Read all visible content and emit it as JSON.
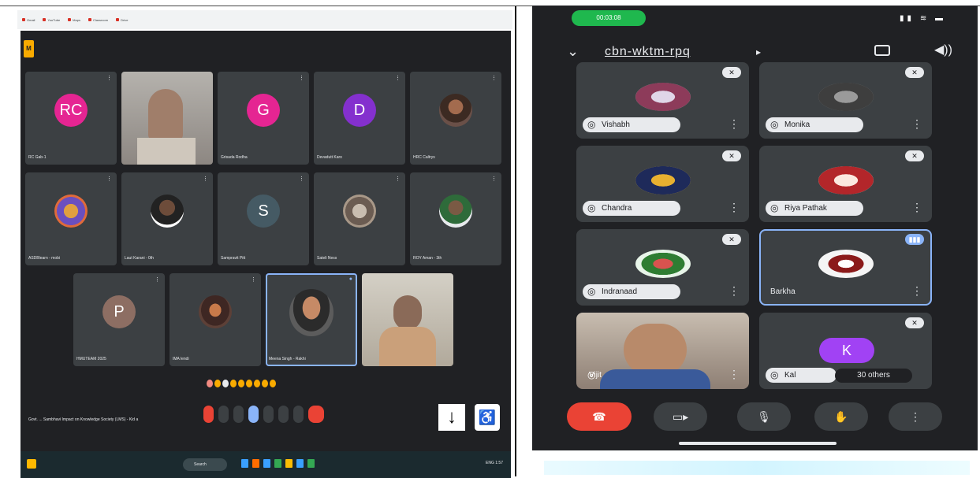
{
  "left": {
    "bookmarks": [
      "Gmail",
      "YouTube",
      "Maps",
      "Classroom",
      "Drive"
    ],
    "meeting_title": "Govt. ... Sambhavi Impact on Knowledge Society (LMS) - Kid a",
    "tiles": [
      {
        "initials": "RC",
        "name": "RC Gab-1",
        "color": "#e52592",
        "video": false
      },
      {
        "initials": "",
        "name": "",
        "color": "",
        "video": true
      },
      {
        "initials": "G",
        "name": "Grisada Rodha",
        "color": "#e52592",
        "video": false
      },
      {
        "initials": "D",
        "name": "Devadutt Karo",
        "color": "#8430ce",
        "video": false
      },
      {
        "initials": "",
        "name": "HRC Caltrys",
        "color": "#6a5048",
        "video": false,
        "photo": true
      },
      {
        "initials": "",
        "name": "ASDBlearn - mobi",
        "color": "#6a5048",
        "video": false,
        "photo": true
      },
      {
        "initials": "",
        "name": "Laut Karani - 0th",
        "color": "#ffffff",
        "video": false,
        "photo": true
      },
      {
        "initials": "S",
        "name": "Sampravit Pitt",
        "color": "#5f6368",
        "video": false
      },
      {
        "initials": "",
        "name": "Sateli Ness",
        "color": "#8d7b70",
        "video": false,
        "photo": true
      },
      {
        "initials": "",
        "name": "ROY Aman - 3th",
        "color": "#e8eaed",
        "video": false,
        "photo": true
      },
      {
        "initials": "P",
        "name": "HMUTEAM 2025",
        "color": "#8d6e63",
        "video": false
      },
      {
        "initials": "",
        "name": "IMA lendi",
        "color": "#5d4037",
        "video": false,
        "photo": true
      },
      {
        "initials": "",
        "name": "Meena Singh - Rakhi",
        "color": "#4e4e4e",
        "video": false,
        "photo": true,
        "speaking": true
      },
      {
        "initials": "",
        "name": "",
        "color": "",
        "video": true
      }
    ],
    "taskbar": {
      "search": "Search",
      "tray": "ENG 1:57"
    }
  },
  "right": {
    "status_time": "00:03:08",
    "meeting_code": "cbn-wktm-rpq",
    "tiles": [
      {
        "name": "Vishabh"
      },
      {
        "name": "Monika"
      },
      {
        "name": "Chandra"
      },
      {
        "name": "Riya Pathak"
      },
      {
        "name": "Indranaad"
      },
      {
        "name": "Barkha",
        "active": true
      },
      {
        "name": "Vijit",
        "video": true
      },
      {
        "name": "Kal",
        "initial": "K",
        "others": "30 others"
      }
    ],
    "controls": [
      "end-call",
      "camera",
      "mic",
      "hand",
      "more"
    ]
  }
}
